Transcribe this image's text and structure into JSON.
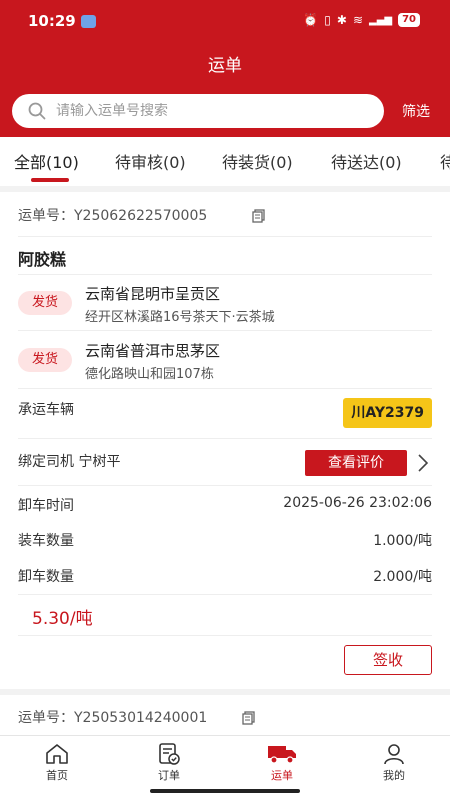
{
  "status": {
    "time": "10:29",
    "battery": "70",
    "network": "5G"
  },
  "header": {
    "title": "运单",
    "search_placeholder": "请输入运单号搜索",
    "filter_label": "筛选"
  },
  "tabs": [
    {
      "label": "全部(10)"
    },
    {
      "label": "待审核(0)"
    },
    {
      "label": "待装货(0)"
    },
    {
      "label": "待送达(0)"
    },
    {
      "label": "待"
    }
  ],
  "card1": {
    "waybill_label": "运单号：Y25062622570005",
    "goods": "阿胶糕",
    "ship_badge": "发货",
    "from": {
      "line1": "云南省昆明市呈贡区",
      "line2": "经开区林溪路16号茶天下·云茶城"
    },
    "to": {
      "line1": "云南省普洱市思茅区",
      "line2": "德化路映山和园107栋"
    },
    "vehicle_label": "承运车辆",
    "plate": "川AY2379",
    "driver_label": "绑定司机  宁树平",
    "eval_button": "查看评价",
    "unload_time_label": "卸车时间",
    "unload_time": "2025-06-26 23:02:06",
    "load_qty_label": "装车数量",
    "load_qty": "1.000/吨",
    "unload_qty_label": "卸车数量",
    "unload_qty": "2.000/吨",
    "price": "5.30/吨",
    "sign_button": "签收"
  },
  "card2": {
    "waybill_label": "运单号：Y25053014240001"
  },
  "nav": [
    {
      "label": "首页",
      "icon": "home-icon"
    },
    {
      "label": "订单",
      "icon": "order-icon"
    },
    {
      "label": "运单",
      "icon": "truck-icon"
    },
    {
      "label": "我的",
      "icon": "user-icon"
    }
  ],
  "colors": {
    "brand": "#c8171e",
    "plate": "#f5c518"
  }
}
